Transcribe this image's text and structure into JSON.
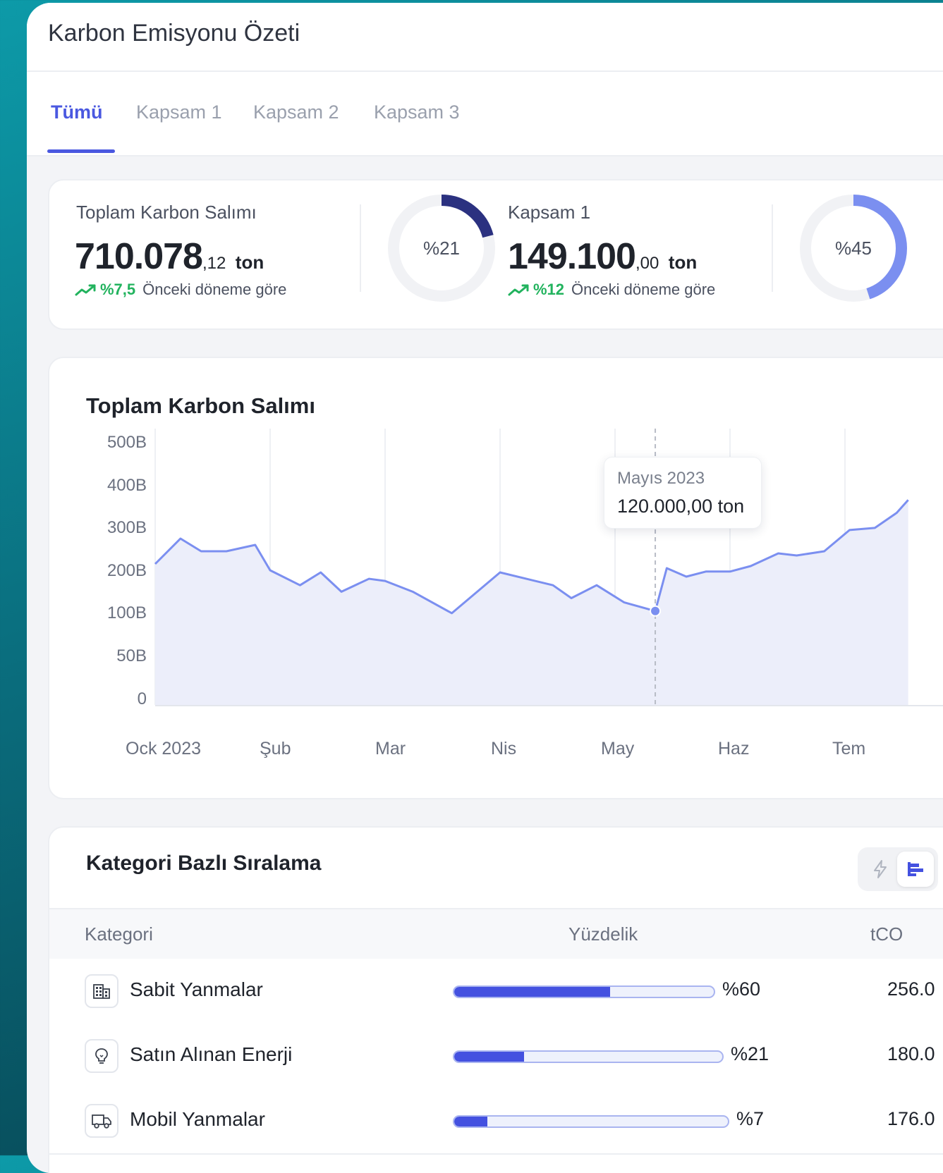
{
  "app": {
    "title": "Karbon Emisyonu Özeti"
  },
  "tabs": [
    {
      "label": "Tümü",
      "active": true
    },
    {
      "label": "Kapsam 1",
      "active": false
    },
    {
      "label": "Kapsam 2",
      "active": false
    },
    {
      "label": "Kapsam 3",
      "active": false
    }
  ],
  "summary": [
    {
      "label": "Toplam Karbon Salımı",
      "value_int": "710.078",
      "value_dec": ",12",
      "unit": "ton",
      "trend_pct": "%7,5",
      "trend_text": "Önceki döneme göre",
      "donut_label": "%21",
      "donut_fraction": 0.21,
      "donut_color": "#2b3180"
    },
    {
      "label": "Kapsam 1",
      "value_int": "149.100",
      "value_dec": ",00",
      "unit": "ton",
      "trend_pct": "%12",
      "trend_text": "Önceki döneme göre",
      "donut_label": "%45",
      "donut_fraction": 0.45,
      "donut_color": "#7b8ff0"
    }
  ],
  "chart": {
    "title": "Toplam Karbon Salımı",
    "y_ticks": [
      "500B",
      "400B",
      "300B",
      "200B",
      "100B",
      "50B",
      "0"
    ],
    "x_ticks": [
      "Ock 2023",
      "Şub",
      "Mar",
      "Nis",
      "May",
      "Haz",
      "Tem"
    ],
    "tooltip": {
      "date": "Mayıs 2023",
      "value": "120.000,00 ton"
    }
  },
  "chart_data": {
    "type": "area",
    "title": "Toplam Karbon Salımı",
    "xlabel": "",
    "ylabel": "",
    "y_tick_labels": [
      "0",
      "50B",
      "100B",
      "200B",
      "300B",
      "400B",
      "500B"
    ],
    "y_tick_values": [
      0,
      50000,
      100000,
      200000,
      300000,
      400000,
      500000
    ],
    "x_tick_labels": [
      "Ock 2023",
      "Şub",
      "Mar",
      "Nis",
      "May",
      "Haz",
      "Tem"
    ],
    "x": [
      0,
      0.22,
      0.4,
      0.62,
      0.87,
      1.0,
      1.26,
      1.44,
      1.62,
      1.86,
      2.0,
      2.24,
      2.58,
      3.0,
      3.46,
      3.62,
      3.84,
      4.08,
      4.35,
      4.45,
      4.62,
      4.79,
      5.0,
      5.18,
      5.42,
      5.58,
      5.82,
      6.04,
      6.26,
      6.45,
      6.55
    ],
    "series": [
      {
        "values": [
          230000,
          290000,
          260000,
          260000,
          275000,
          215000,
          180000,
          210000,
          165000,
          195000,
          190000,
          165000,
          115000,
          210000,
          180000,
          150000,
          180000,
          140000,
          120000,
          220000,
          200000,
          212000,
          212000,
          225000,
          255000,
          250000,
          260000,
          310000,
          315000,
          350000,
          380000
        ]
      }
    ],
    "highlight": {
      "label": "Mayıs 2023",
      "value": 120000,
      "value_text": "120.000,00 ton"
    },
    "ylim": [
      0,
      500000
    ],
    "grid": "vertical",
    "colors": {
      "line": "#7b8ff0",
      "fill": "#eceefa"
    }
  },
  "ranking": {
    "title": "Kategori Bazlı Sıralama",
    "columns": {
      "category": "Kategori",
      "percent": "Yüzdelik",
      "value": "tCO"
    },
    "view_toggle": {
      "options": [
        "lightning-icon",
        "bar-list-icon"
      ],
      "selected": "bar-list-icon"
    },
    "rows": [
      {
        "name": "Sabit Yanmalar",
        "percent_label": "%60",
        "fraction": 0.6,
        "value": "256.0",
        "icon": "building-icon"
      },
      {
        "name": "Satın Alınan Enerji",
        "percent_label": "%21",
        "fraction": 0.26,
        "value": "180.0",
        "icon": "lightbulb-icon"
      },
      {
        "name": "Mobil Yanmalar",
        "percent_label": "%7",
        "fraction": 0.12,
        "value": "176.0",
        "icon": "truck-icon"
      }
    ]
  }
}
